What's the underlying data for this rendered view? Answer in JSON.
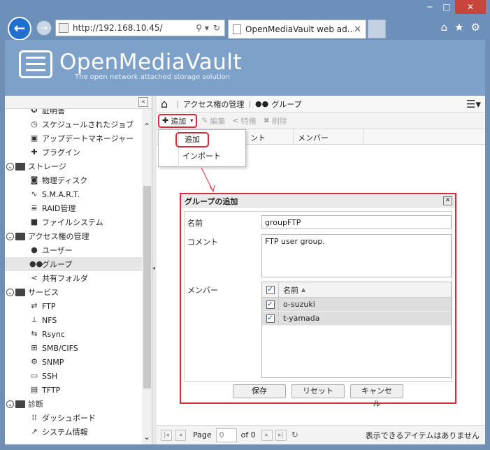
{
  "browser": {
    "url": "http://192.168.10.45/",
    "tab_title": "OpenMediaVault web ad...",
    "window_controls": [
      "─",
      "□",
      "✕"
    ]
  },
  "app": {
    "brand": "OpenMediaVault",
    "tagline": "The open network attached storage solution"
  },
  "nav": {
    "items": [
      {
        "label": "証明書",
        "icon": "certificate-icon"
      },
      {
        "label": "スケジュールされたジョブ",
        "icon": "clock-icon"
      },
      {
        "label": "アップデートマネージャー",
        "icon": "package-icon"
      },
      {
        "label": "プラグイン",
        "icon": "puzzle-icon"
      },
      {
        "label": "ストレージ",
        "icon": "folder-icon"
      },
      {
        "label": "物理ディスク",
        "icon": "disk-icon"
      },
      {
        "label": "S.M.A.R.T.",
        "icon": "pulse-icon"
      },
      {
        "label": "RAID管理",
        "icon": "database-icon"
      },
      {
        "label": "ファイルシステム",
        "icon": "folder-icon"
      },
      {
        "label": "アクセス権の管理",
        "icon": "folder-icon"
      },
      {
        "label": "ユーザー",
        "icon": "user-icon"
      },
      {
        "label": "グループ",
        "icon": "group-icon"
      },
      {
        "label": "共有フォルダ",
        "icon": "share-icon"
      },
      {
        "label": "サービス",
        "icon": "folder-icon"
      },
      {
        "label": "FTP",
        "icon": "ftp-icon"
      },
      {
        "label": "NFS",
        "icon": "nfs-icon"
      },
      {
        "label": "Rsync",
        "icon": "rsync-icon"
      },
      {
        "label": "SMB/CIFS",
        "icon": "windows-icon"
      },
      {
        "label": "SNMP",
        "icon": "gear-icon"
      },
      {
        "label": "SSH",
        "icon": "terminal-icon"
      },
      {
        "label": "TFTP",
        "icon": "tftp-icon"
      },
      {
        "label": "診断",
        "icon": "folder-icon"
      },
      {
        "label": "ダッシュボード",
        "icon": "grid-icon"
      },
      {
        "label": "システム情報",
        "icon": "chart-icon"
      }
    ]
  },
  "breadcrumb": {
    "section": "アクセス権の管理",
    "page": "グループ"
  },
  "toolbar": {
    "add": "追加",
    "edit": "編集",
    "privileges": "特権",
    "delete": "削除"
  },
  "grid": {
    "columns": [
      "ント",
      "メンバー"
    ]
  },
  "dropdown": {
    "add": "追加",
    "import": "インポート"
  },
  "dialog": {
    "title": "グループの追加",
    "name_label": "名前",
    "name_value": "groupFTP",
    "comment_label": "コメント",
    "comment_value": "FTP user group.",
    "members_label": "メンバー",
    "member_col": "名前",
    "members": [
      "o-suzuki",
      "t-yamada"
    ],
    "save": "保存",
    "reset": "リセット",
    "cancel": "キャンセル"
  },
  "pager": {
    "page_label": "Page",
    "page_value": "0",
    "of_label": "of 0",
    "empty_msg": "表示できるアイテムはありません"
  },
  "colors": {
    "highlight": "#d62b3a",
    "header": "#7da1c8"
  }
}
